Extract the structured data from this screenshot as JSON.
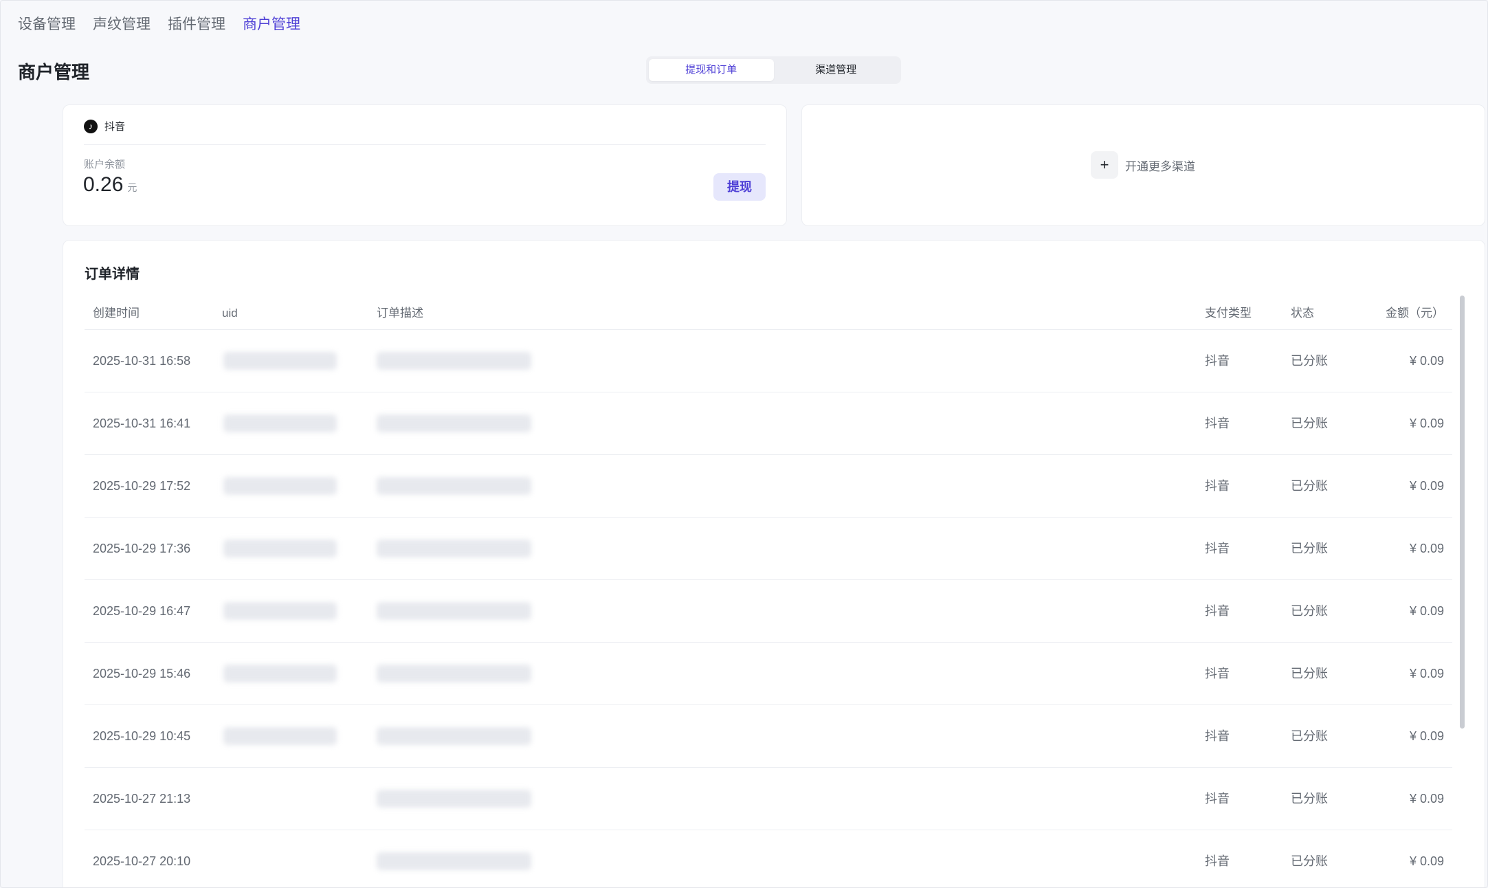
{
  "nav": {
    "items": [
      {
        "label": "设备管理",
        "active": false
      },
      {
        "label": "声纹管理",
        "active": false
      },
      {
        "label": "插件管理",
        "active": false
      },
      {
        "label": "商户管理",
        "active": true
      }
    ]
  },
  "page": {
    "title": "商户管理"
  },
  "segmented": {
    "tabs": [
      {
        "label": "提现和订单",
        "active": true
      },
      {
        "label": "渠道管理",
        "active": false
      }
    ]
  },
  "balance_card": {
    "channel": {
      "name": "抖音",
      "icon": "tiktok-icon"
    },
    "balance_label": "账户余额",
    "balance_value": "0.26",
    "balance_unit": "元",
    "withdraw_label": "提现"
  },
  "more_channels": {
    "icon": "plus-icon",
    "label": "开通更多渠道"
  },
  "orders": {
    "title": "订单详情",
    "columns": {
      "time": "创建时间",
      "uid": "uid",
      "desc": "订单描述",
      "pay_type": "支付类型",
      "status": "状态",
      "amount": "金额（元）"
    },
    "rows": [
      {
        "time": "2025-10-31 16:58",
        "pay_type": "抖音",
        "status": "已分账",
        "amount": "¥ 0.09"
      },
      {
        "time": "2025-10-31 16:41",
        "pay_type": "抖音",
        "status": "已分账",
        "amount": "¥ 0.09"
      },
      {
        "time": "2025-10-29 17:52",
        "pay_type": "抖音",
        "status": "已分账",
        "amount": "¥ 0.09"
      },
      {
        "time": "2025-10-29 17:36",
        "pay_type": "抖音",
        "status": "已分账",
        "amount": "¥ 0.09"
      },
      {
        "time": "2025-10-29 16:47",
        "pay_type": "抖音",
        "status": "已分账",
        "amount": "¥ 0.09"
      },
      {
        "time": "2025-10-29 15:46",
        "pay_type": "抖音",
        "status": "已分账",
        "amount": "¥ 0.09"
      },
      {
        "time": "2025-10-29 10:45",
        "pay_type": "抖音",
        "status": "已分账",
        "amount": "¥ 0.09"
      },
      {
        "time": "2025-10-27 21:13",
        "pay_type": "抖音",
        "status": "已分账",
        "amount": "¥ 0.09"
      },
      {
        "time": "2025-10-27 20:10",
        "pay_type": "抖音",
        "status": "已分账",
        "amount": "¥ 0.09"
      }
    ]
  },
  "colors": {
    "accent": "#4e3fd6",
    "accent_bg": "#e6e7fc",
    "muted_text": "#646a73"
  }
}
